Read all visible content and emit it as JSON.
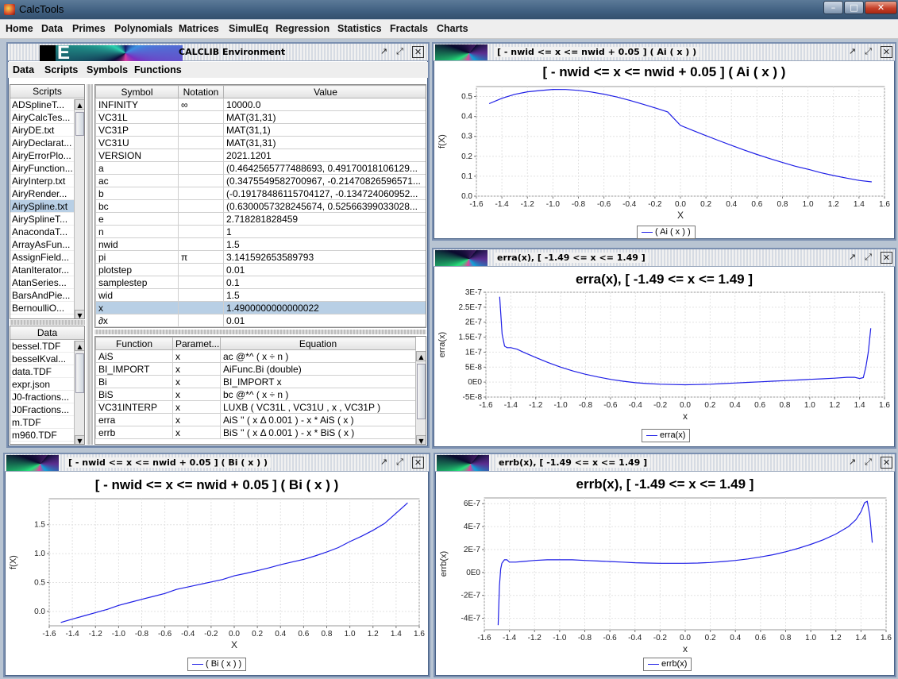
{
  "app": {
    "title": "CalcTools"
  },
  "window_controls": {
    "minimize": "–",
    "maximize": "□",
    "close": "✕"
  },
  "menubar": [
    "Home",
    "Data",
    "Primes",
    "Polynomials",
    "Matrices",
    "SimulEq",
    "Regression",
    "Statistics",
    "Fractals",
    "Charts"
  ],
  "frame_controls": {
    "restore": "↗",
    "maximize": "⤢",
    "close": "✕"
  },
  "calclib": {
    "title": "CALCLIB Environment",
    "logo_letter": "E",
    "submenu": [
      "Data",
      "Scripts",
      "Symbols",
      "Functions"
    ],
    "scripts_header": "Scripts",
    "scripts": [
      "ADSplineT...",
      "AiryCalcTes...",
      "AiryDE.txt",
      "AiryDeclarat...",
      "AiryErrorPlo...",
      "AiryFunction...",
      "AiryInterp.txt",
      "AiryRender...",
      "AirySpline.txt",
      "AirySplineT...",
      "AnacondaT...",
      "ArrayAsFun...",
      "AssignField...",
      "AtanIterator...",
      "AtanSeries...",
      "BarsAndPie...",
      "BernoulliO..."
    ],
    "scripts_selected": 8,
    "data_header": "Data",
    "data_files": [
      "bessel.TDF",
      "besselKval...",
      "data.TDF",
      "expr.json",
      "J0-fractions...",
      "J0Fractions...",
      "m.TDF",
      "m960.TDF"
    ],
    "symbols": {
      "headers": [
        "Symbol",
        "Notation",
        "Value"
      ],
      "rows": [
        [
          "INFINITY",
          "∞",
          "10000.0"
        ],
        [
          "VC31L",
          "",
          "MAT(31,31)"
        ],
        [
          "VC31P",
          "",
          "MAT(31,1)"
        ],
        [
          "VC31U",
          "",
          "MAT(31,31)"
        ],
        [
          "VERSION",
          "",
          "2021.1201"
        ],
        [
          "a",
          "",
          "(0.4642565777488693, 0.49170018106129..."
        ],
        [
          "ac",
          "",
          "(0.3475549582700967, -0.21470826596571..."
        ],
        [
          "b",
          "",
          "(-0.19178486115704127, -0.134724060952..."
        ],
        [
          "bc",
          "",
          "(0.6300057328245674, 0.52566399033028..."
        ],
        [
          "e",
          "",
          "2.718281828459"
        ],
        [
          "n",
          "",
          "1"
        ],
        [
          "nwid",
          "",
          "1.5"
        ],
        [
          "pi",
          "π",
          "3.141592653589793"
        ],
        [
          "plotstep",
          "",
          "0.01"
        ],
        [
          "samplestep",
          "",
          "0.1"
        ],
        [
          "wid",
          "",
          "1.5"
        ],
        [
          "x",
          "",
          "1.4900000000000022"
        ],
        [
          "∂x",
          "",
          "0.01"
        ]
      ],
      "selected": 16
    },
    "functions": {
      "headers": [
        "Function",
        "Paramet...",
        "Equation"
      ],
      "rows": [
        [
          "AiS",
          "x",
          "ac @*^ ( x ÷ n )"
        ],
        [
          "BI_IMPORT",
          "x",
          "AiFunc.Bi (double)"
        ],
        [
          "Bi",
          "x",
          "BI_IMPORT x"
        ],
        [
          "BiS",
          "x",
          "bc @*^ ( x ÷ n )"
        ],
        [
          "VC31INTERP",
          "x",
          "LUXB ( VC31L , VC31U , x , VC31P )"
        ],
        [
          "erra",
          "x",
          "AiS '' ( x Δ 0.001 ) - x * AiS ( x )"
        ],
        [
          "errb",
          "x",
          "BiS '' ( x Δ 0.001 ) - x * BiS ( x )"
        ]
      ]
    }
  },
  "plots": {
    "ai": {
      "frame_title": "[ - nwid <= x <= nwid + 0.05  ]  ( Ai ( x ) )",
      "title": "[ - nwid <= x <= nwid + 0.05  ]  ( Ai ( x ) )",
      "xlabel": "X",
      "ylabel": "f(X)",
      "xticks": [
        "-1.6",
        "-1.4",
        "-1.2",
        "-1.0",
        "-0.8",
        "-0.6",
        "-0.4",
        "-0.2",
        "0.0",
        "0.2",
        "0.4",
        "0.6",
        "0.8",
        "1.0",
        "1.2",
        "1.4",
        "1.6"
      ],
      "yticks": [
        "0.0",
        "0.1",
        "0.2",
        "0.3",
        "0.4",
        "0.5"
      ],
      "legend": "( Ai ( x ) )"
    },
    "bi": {
      "frame_title": "[ - nwid <= x <= nwid + 0.05  ]  ( Bi ( x ) )",
      "title": "[ - nwid <= x <= nwid + 0.05  ]  ( Bi ( x ) )",
      "xlabel": "X",
      "ylabel": "f(X)",
      "xticks": [
        "-1.6",
        "-1.4",
        "-1.2",
        "-1.0",
        "-0.8",
        "-0.6",
        "-0.4",
        "-0.2",
        "0.0",
        "0.2",
        "0.4",
        "0.6",
        "0.8",
        "1.0",
        "1.2",
        "1.4",
        "1.6"
      ],
      "yticks": [
        "0.0",
        "0.5",
        "1.0",
        "1.5"
      ],
      "legend": "( Bi ( x ) )"
    },
    "erra": {
      "frame_title": "erra(x), [ -1.49 <= x <= 1.49 ]",
      "title": "erra(x), [ -1.49 <= x <= 1.49 ]",
      "xlabel": "x",
      "ylabel": "erra(x)",
      "xticks": [
        "-1.6",
        "-1.4",
        "-1.2",
        "-1.0",
        "-0.8",
        "-0.6",
        "-0.4",
        "-0.2",
        "0.0",
        "0.2",
        "0.4",
        "0.6",
        "0.8",
        "1.0",
        "1.2",
        "1.4",
        "1.6"
      ],
      "yticks": [
        "-5E-8",
        "0E0",
        "5E-8",
        "1E-7",
        "1.5E-7",
        "2E-7",
        "2.5E-7",
        "3E-7"
      ],
      "legend": "erra(x)"
    },
    "errb": {
      "frame_title": "errb(x), [ -1.49 <= x <= 1.49 ]",
      "title": "errb(x), [ -1.49 <= x <= 1.49 ]",
      "xlabel": "x",
      "ylabel": "errb(x)",
      "xticks": [
        "-1.6",
        "-1.4",
        "-1.2",
        "-1.0",
        "-0.8",
        "-0.6",
        "-0.4",
        "-0.2",
        "0.0",
        "0.2",
        "0.4",
        "0.6",
        "0.8",
        "1.0",
        "1.2",
        "1.4",
        "1.6"
      ],
      "yticks": [
        "-4E-7",
        "-2E-7",
        "0E0",
        "2E-7",
        "4E-7",
        "6E-7"
      ],
      "legend": "errb(x)"
    }
  },
  "chart_data": [
    {
      "type": "line",
      "title": "[ - nwid <= x <= nwid + 0.05  ]  ( Ai ( x ) )",
      "xlabel": "X",
      "ylabel": "f(X)",
      "xlim": [
        -1.6,
        1.6
      ],
      "ylim": [
        0.0,
        0.55
      ],
      "grid": true,
      "legend": "bottom-center",
      "series": [
        {
          "name": "( Ai ( x ) )",
          "color": "#1f1fe6",
          "x": [
            -1.5,
            -1.4,
            -1.3,
            -1.2,
            -1.1,
            -1.0,
            -0.9,
            -0.8,
            -0.7,
            -0.6,
            -0.5,
            -0.4,
            -0.3,
            -0.2,
            -0.1,
            0.0,
            0.1,
            0.2,
            0.3,
            0.4,
            0.5,
            0.6,
            0.7,
            0.8,
            0.9,
            1.0,
            1.1,
            1.2,
            1.3,
            1.4,
            1.5
          ],
          "y": [
            0.4642,
            0.491,
            0.5108,
            0.5237,
            0.5301,
            0.5356,
            0.5354,
            0.5309,
            0.5228,
            0.5118,
            0.4976,
            0.4811,
            0.4629,
            0.4433,
            0.4228,
            0.355,
            0.3292,
            0.3037,
            0.2788,
            0.2547,
            0.2316,
            0.2094,
            0.1885,
            0.1688,
            0.1504,
            0.1353,
            0.1179,
            0.1037,
            0.091,
            0.0788,
            0.0717
          ]
        }
      ]
    },
    {
      "type": "line",
      "title": "[ - nwid <= x <= nwid + 0.05  ]  ( Bi ( x ) )",
      "xlabel": "X",
      "ylabel": "f(X)",
      "xlim": [
        -1.6,
        1.6
      ],
      "ylim": [
        -0.25,
        1.95
      ],
      "grid": true,
      "legend": "bottom-center",
      "series": [
        {
          "name": "( Bi ( x ) )",
          "color": "#1f1fe6",
          "x": [
            -1.5,
            -1.4,
            -1.3,
            -1.2,
            -1.1,
            -1.0,
            -0.9,
            -0.8,
            -0.7,
            -0.6,
            -0.5,
            -0.4,
            -0.3,
            -0.2,
            -0.1,
            0.0,
            0.1,
            0.2,
            0.3,
            0.4,
            0.5,
            0.6,
            0.7,
            0.8,
            0.9,
            1.0,
            1.1,
            1.2,
            1.3,
            1.4,
            1.5
          ],
          "y": [
            -0.1918,
            -0.1348,
            -0.0781,
            -0.0221,
            0.0327,
            0.104,
            0.156,
            0.2075,
            0.259,
            0.31,
            0.3804,
            0.422,
            0.466,
            0.509,
            0.552,
            0.6149,
            0.658,
            0.704,
            0.753,
            0.807,
            0.8543,
            0.9,
            0.96,
            1.027,
            1.104,
            1.2074,
            1.3,
            1.403,
            1.521,
            1.7,
            1.8789
          ]
        }
      ]
    },
    {
      "type": "line",
      "title": "erra(x), [ -1.49 <= x <= 1.49 ]",
      "xlabel": "x",
      "ylabel": "erra(x)",
      "xlim": [
        -1.6,
        1.6
      ],
      "ylim": [
        -5e-08,
        3e-07
      ],
      "grid": true,
      "legend": "bottom-center",
      "series": [
        {
          "name": "erra(x)",
          "color": "#1f1fe6",
          "x": [
            -1.49,
            -1.47,
            -1.45,
            -1.43,
            -1.4,
            -1.35,
            -1.3,
            -1.2,
            -1.1,
            -1.0,
            -0.9,
            -0.8,
            -0.7,
            -0.6,
            -0.5,
            -0.4,
            -0.3,
            -0.2,
            -0.1,
            0.0,
            0.1,
            0.2,
            0.3,
            0.4,
            0.5,
            0.6,
            0.7,
            0.8,
            0.9,
            1.0,
            1.1,
            1.2,
            1.3,
            1.36,
            1.4,
            1.43,
            1.45,
            1.47,
            1.49
          ],
          "y": [
            2.85e-07,
            1.6e-07,
            1.2e-07,
            1.15e-07,
            1.15e-07,
            1.1e-07,
            1e-07,
            8.2e-08,
            6.5e-08,
            5e-08,
            3.7e-08,
            2.6e-08,
            1.7e-08,
            9e-09,
            3e-09,
            -2e-09,
            -5e-09,
            -7e-09,
            -8e-09,
            -9e-09,
            -8e-09,
            -7e-09,
            -5e-09,
            -3e-09,
            -1e-09,
            1e-09,
            3e-09,
            5e-09,
            7e-09,
            9e-09,
            1.1e-08,
            1.3e-08,
            1.6e-08,
            1.6e-08,
            1.2e-08,
            1.5e-08,
            5e-08,
            1e-07,
            1.8e-07
          ]
        }
      ]
    },
    {
      "type": "line",
      "title": "errb(x), [ -1.49 <= x <= 1.49 ]",
      "xlabel": "x",
      "ylabel": "errb(x)",
      "xlim": [
        -1.6,
        1.6
      ],
      "ylim": [
        -5e-07,
        6.5e-07
      ],
      "grid": true,
      "legend": "bottom-center",
      "series": [
        {
          "name": "errb(x)",
          "color": "#1f1fe6",
          "x": [
            -1.49,
            -1.48,
            -1.47,
            -1.46,
            -1.44,
            -1.42,
            -1.4,
            -1.35,
            -1.3,
            -1.2,
            -1.1,
            -1.0,
            -0.9,
            -0.8,
            -0.7,
            -0.6,
            -0.5,
            -0.4,
            -0.3,
            -0.2,
            -0.1,
            0.0,
            0.1,
            0.2,
            0.3,
            0.4,
            0.5,
            0.6,
            0.7,
            0.8,
            0.9,
            1.0,
            1.1,
            1.2,
            1.3,
            1.36,
            1.4,
            1.43,
            1.45,
            1.47,
            1.49
          ],
          "y": [
            -4.6e-07,
            -1.2e-07,
            3e-08,
            8e-08,
            1.1e-07,
            1.1e-07,
            9e-08,
            9e-08,
            9.5e-08,
            1.05e-07,
            1.1e-07,
            1.1e-07,
            1.1e-07,
            1.05e-07,
            1e-07,
            9.5e-08,
            9e-08,
            8.5e-08,
            8.2e-08,
            8e-08,
            8e-08,
            8e-08,
            8.2e-08,
            8.7e-08,
            9.5e-08,
            1.05e-07,
            1.18e-07,
            1.35e-07,
            1.55e-07,
            1.8e-07,
            2.1e-07,
            2.45e-07,
            2.85e-07,
            3.35e-07,
            4e-07,
            4.6e-07,
            5.3e-07,
            6.1e-07,
            6.2e-07,
            5e-07,
            2.6e-07
          ]
        }
      ]
    }
  ]
}
